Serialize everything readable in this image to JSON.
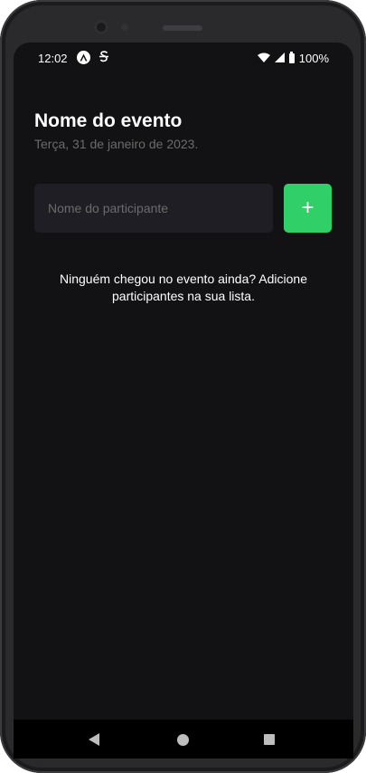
{
  "status_bar": {
    "time": "12:02",
    "icons": [
      "expo-icon",
      "sync-icon",
      "wifi-icon",
      "signal-icon",
      "battery-icon"
    ],
    "battery": "100%"
  },
  "event": {
    "title": "Nome do evento",
    "date": "Terça, 31 de janeiro de 2023."
  },
  "form": {
    "placeholder": "Nome do participante",
    "value": "",
    "add_label": "+"
  },
  "empty_message": "Ninguém chegou no evento ainda? Adicione participantes na sua lista.",
  "colors": {
    "background": "#121214",
    "input_background": "#1f1e25",
    "accent": "#31cf67",
    "muted_text": "#6b6b6b"
  }
}
